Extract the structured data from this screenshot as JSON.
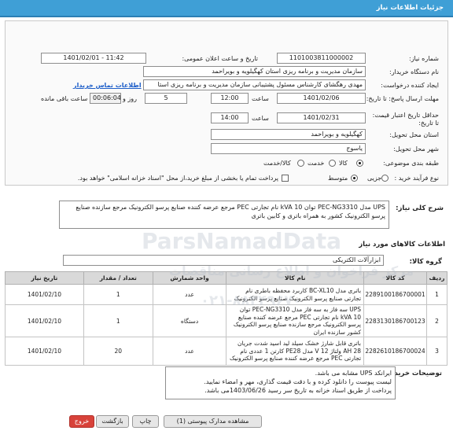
{
  "header": {
    "title": "جزئیات اطلاعات نیاز"
  },
  "form": {
    "need_number_label": "شماره نیاز:",
    "need_number": "1101003811000002",
    "announce_label": "تاریخ و ساعت اعلان عمومی:",
    "announce_value": "1401/02/01 - 11:42",
    "buyer_org_label": "نام دستگاه خریدار:",
    "buyer_org": "سازمان مدیریت و برنامه ریزی استان کهگیلویه و بویراحمد",
    "creator_label": "ایجاد کننده درخواست:",
    "creator": "مهدی رهگشای کارشناس مسئول پشتیبانی سازمان مدیریت و برنامه ریزی استا",
    "buyer_contact_link": "اطلاعات تماس خریدار",
    "deadline_label": "مهلت ارسال پاسخ: تا تاریخ:",
    "deadline_date": "1401/02/06",
    "time_label": "ساعت",
    "deadline_time": "12:00",
    "days_value": "5",
    "days_label": "روز و",
    "remaining_time": "00:06:04",
    "remaining_label": "ساعت باقی مانده",
    "validity_label": "حداقل تاریخ اعتبار قیمت: تا تاریخ:",
    "validity_date": "1401/02/31",
    "validity_time": "14:00",
    "province_label": "استان محل تحویل:",
    "province": "کهگیلویه و بویراحمد",
    "city_label": "شهر محل تحویل:",
    "city": "یاسوج",
    "category_label": "طبقه بندی موضوعی:",
    "category_options": [
      "کالا",
      "خدمت",
      "کالا/خدمت"
    ],
    "category_selected": "کالا",
    "purchase_type_label": "نوع فرآیند خرید :",
    "purchase_options": [
      "جزیی",
      "متوسط"
    ],
    "purchase_selected": "متوسط",
    "payment_note": "پرداخت تمام یا بخشی از مبلغ خرید،از محل \"اسناد خزانه اسلامی\" خواهد بود."
  },
  "need_description": {
    "label": "شرح کلی نیاز:",
    "text": "UPS مدل PEC-NG3310 توان kVA 10 نام تجارتی PEC مرجع عرضه کننده صنایع پرسو الکترونیک مرجع سازنده صنایع پرسو الکترونیک کشور به همراه باتری و کابین باتری"
  },
  "goods": {
    "section_title": "اطلاعات کالاهای مورد نیاز",
    "group_label": "گروه کالا:",
    "group_value": "ابزارآلات الکتریکی",
    "columns": [
      "ردیف",
      "کد کالا",
      "نام کالا",
      "واحد شمارش",
      "تعداد / مقدار",
      "تاریخ نیاز"
    ],
    "rows": [
      {
        "row": "1",
        "code": "2289100186700001",
        "name": "باتری مدل BC-XL10 کاربرد محفظه باطری نام تجارتی صنایع پرسو الکترونیک صنایع پرسو الکترونیک",
        "unit": "عدد",
        "qty": "1",
        "date": "1401/02/10"
      },
      {
        "row": "2",
        "code": "2283130186700123",
        "name": "UPS سه فاز به سه فاز مدل PEC-NG3310 توان kVA 10 نام تجارتی PEC مرجع عرضه کننده صنایع پرسو الکترونیک مرجع سازنده صنایع پرسو الکترونیک کشور سازنده ایران",
        "unit": "دستگاه",
        "qty": "1",
        "date": "1401/02/10"
      },
      {
        "row": "3",
        "code": "2282610186700024",
        "name": "باتری قابل شارژ خشک سیلد لید اسید شدت جریان AH 28 ولتاژ V 12 مدل PE28 کارتن 1 عددی نام تجارتی PEC مرجع عرضه کننده صنایع پرسو الکترونیک",
        "unit": "عدد",
        "qty": "20",
        "date": "1401/02/10"
      }
    ]
  },
  "buyer_notes": {
    "label": "توضیحات خریدار:",
    "lines": [
      "ایرانکد UPS مشابه می باشد.",
      "لیست پیوست را دانلود کرده و با دقت قیمت گذاری، مهر و امضاء نمایید.",
      "پرداخت از طریق اسناد خزانه به تاریخ سر رسید 1403/06/26می باشد."
    ]
  },
  "footer": {
    "exit_label": "خروج",
    "back_label": "بازگشت",
    "print_label": "چاپ",
    "attachments_label": "مشاهده مدارک پیوستی (1)"
  },
  "watermark": {
    "brand": "ParsNamadData",
    "tagline": "مرکز فراخوان و اطلاع رسانی مناقصات",
    "phone": "۰۲۱-۸۸۳۴۹۶۷۰"
  },
  "colors": {
    "title_bar": "#3f9fd6",
    "exit_button": "#d8423a",
    "link": "#1d5ec9",
    "header_row": "#d9d9d9"
  }
}
